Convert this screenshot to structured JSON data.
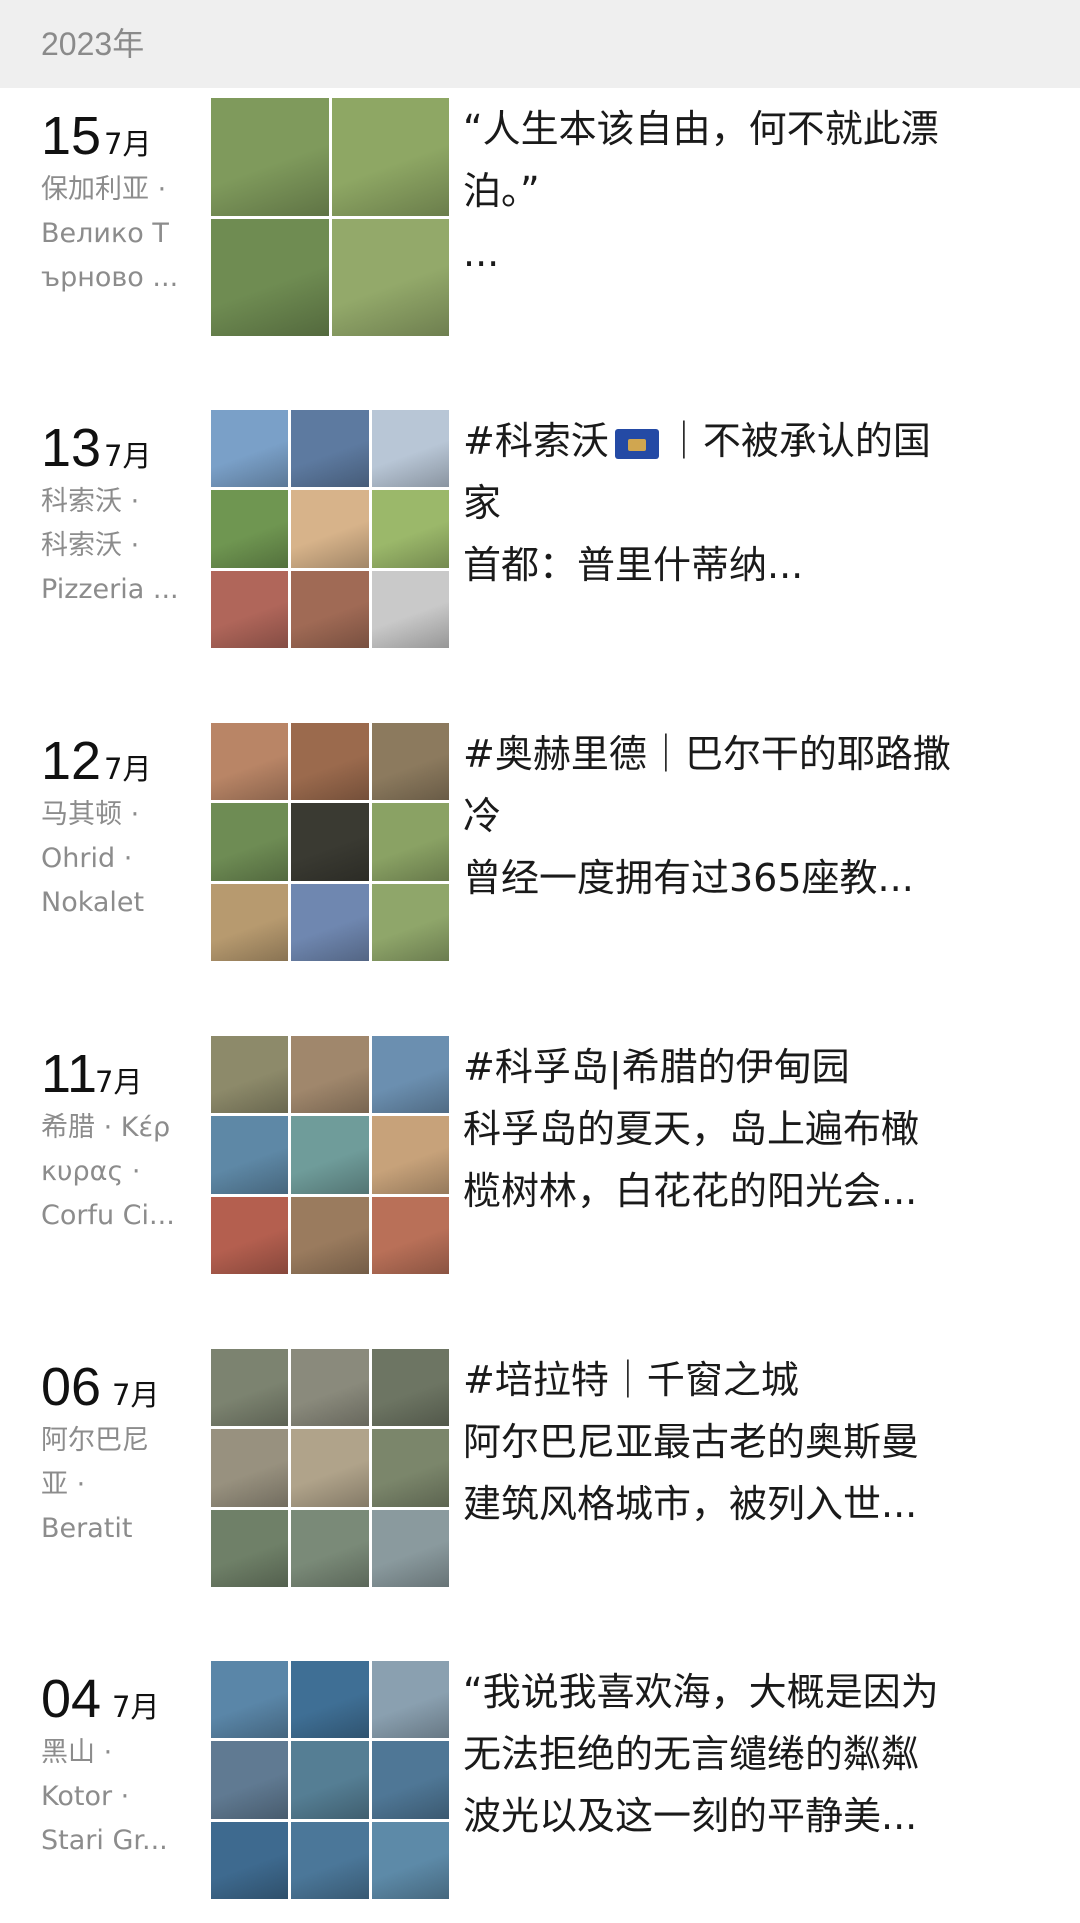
{
  "year": "2023年",
  "entries": [
    {
      "day": "15",
      "month": "7月",
      "location_lines": [
        "保加利亚 ·",
        " Велико Т",
        "ърново ..."
      ],
      "text_lines": [
        "“人生本该自由，何不就此漂",
        "泊。”",
        "..."
      ],
      "thumb_grid": 2,
      "thumb_colors": [
        "#7f9a5c",
        "#8ea764",
        "#6f8c52",
        "#93a96a"
      ]
    },
    {
      "day": "13",
      "month": "7月",
      "location_lines": [
        "科索沃 ·",
        "科索沃 ·",
        "Pizzeria ..."
      ],
      "text_lines": [
        "#科索沃",
        "｜不被承认的国",
        "家",
        "首都：普里什蒂纳..."
      ],
      "thumb_grid": 3,
      "thumb_colors": [
        "#7aa0c8",
        "#5d7aa0",
        "#b8c6d6",
        "#6f9651",
        "#d7b38a",
        "#9bb86a",
        "#b0665a",
        "#a06a55",
        "#c9c9c9"
      ]
    },
    {
      "day": "12",
      "month": "7月",
      "location_lines": [
        "马其顿 ·",
        "Ohrid ·",
        "Nokalet"
      ],
      "text_lines": [
        "#奥赫里德｜巴尔干的耶路撒",
        "冷",
        "曾经一度拥有过365座教..."
      ],
      "thumb_grid": 3,
      "thumb_colors": [
        "#b98566",
        "#9b6a4d",
        "#8c7a5e",
        "#6e8c54",
        "#3a3a32",
        "#8aa264",
        "#b79a6f",
        "#6f87b0",
        "#8fa66a"
      ]
    },
    {
      "day": "11",
      "month": "7月",
      "location_lines": [
        "希腊 · Κέρ",
        "κυρας ·",
        "Corfu Ci..."
      ],
      "text_lines": [
        "#科孚岛|希腊的伊甸园",
        "科孚岛的夏天，岛上遍布橄",
        "榄树林，白花花的阳光会..."
      ],
      "thumb_grid": 3,
      "thumb_colors": [
        "#8d8a6a",
        "#a0876c",
        "#6b8fb0",
        "#5e88a6",
        "#6f9c9a",
        "#c7a27a",
        "#b45f4f",
        "#9a7b5e",
        "#b97058"
      ]
    },
    {
      "day": "06",
      "month": "7月",
      "location_lines": [
        "阿尔巴尼",
        "亚 ·",
        "Beratit"
      ],
      "text_lines": [
        "#培拉特｜千窗之城",
        "阿尔巴尼亚最古老的奥斯曼",
        "建筑风格城市，被列入世..."
      ],
      "thumb_grid": 3,
      "thumb_colors": [
        "#7c8370",
        "#8a8a7c",
        "#6d7563",
        "#98917f",
        "#b0a38a",
        "#7b866b",
        "#6f8068",
        "#7a8a78",
        "#8a9a9e"
      ]
    },
    {
      "day": "04",
      "month": "7月",
      "location_lines": [
        "黑山 ·",
        "Kotor ·",
        "Stari Gr..."
      ],
      "text_lines": [
        "“我说我喜欢海，大概是因为",
        "无法拒绝的无言缱绻的粼粼",
        "波光以及这一刻的平静美..."
      ],
      "thumb_grid": 3,
      "thumb_colors": [
        "#5a86a8",
        "#3f6f95",
        "#8aa0b0",
        "#607a92",
        "#557e94",
        "#4f7796",
        "#3e6a8f",
        "#4b7799",
        "#5d8aa8"
      ]
    }
  ]
}
